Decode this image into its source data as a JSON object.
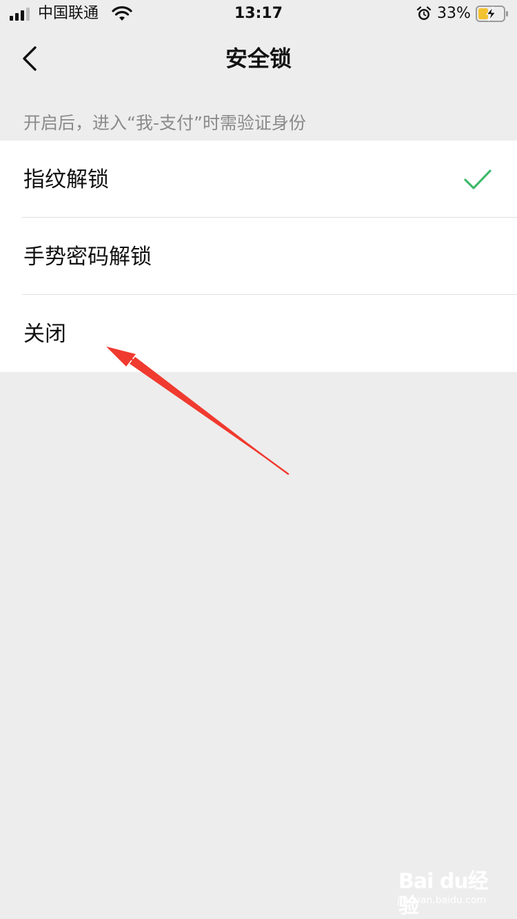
{
  "status_bar": {
    "carrier": "中国联通",
    "time": "13:17",
    "battery_percent": "33%",
    "icons": [
      "signal-icon",
      "wifi-icon",
      "alarm-icon",
      "battery-charging-icon"
    ]
  },
  "nav": {
    "title": "安全锁",
    "back_icon": "chevron-left-icon"
  },
  "hint": "开启后，进入“我-支付”时需验证身份",
  "options": [
    {
      "label": "指纹解锁",
      "selected": true
    },
    {
      "label": "手势密码解锁",
      "selected": false
    },
    {
      "label": "关闭",
      "selected": false
    }
  ],
  "watermark": {
    "brand": "Bai du经验",
    "sub": "jingyan.baidu.com"
  },
  "colors": {
    "background": "#ededed",
    "list_background": "#ffffff",
    "check": "#3fb96b",
    "hint_text": "#8a8a8a",
    "annotation_arrow": "#f03a2f"
  }
}
